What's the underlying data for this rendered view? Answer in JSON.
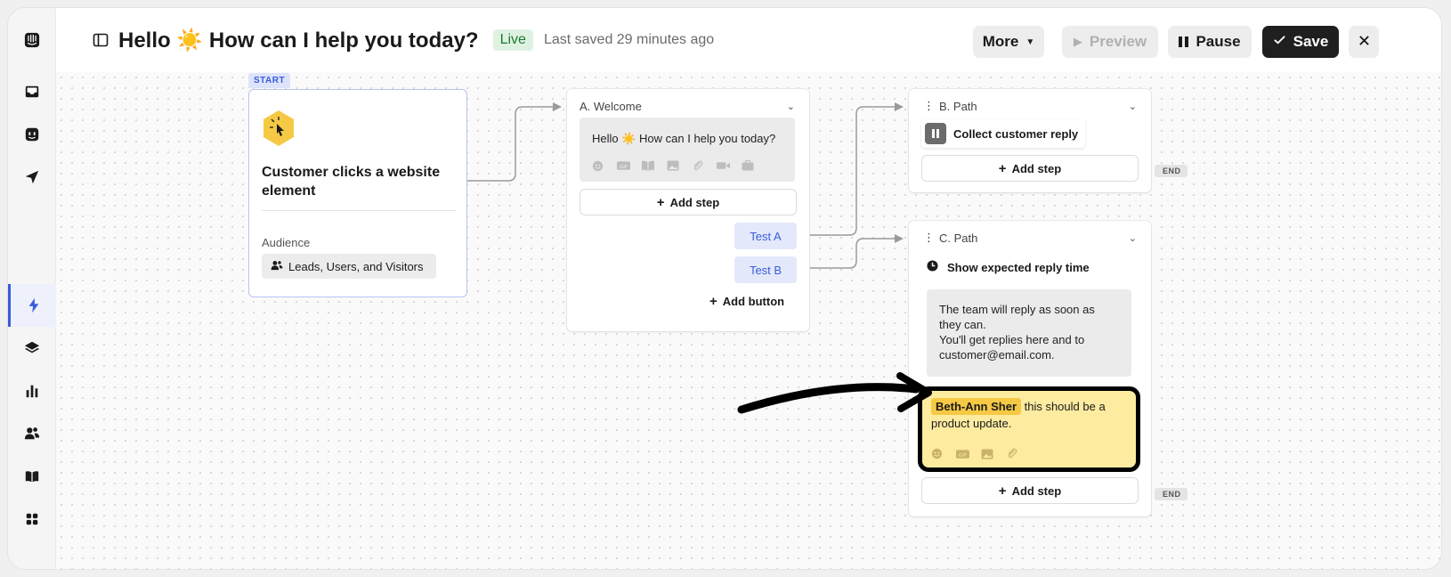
{
  "header": {
    "title": "Hello ☀️ How can I help you today?",
    "status": "Live",
    "last_saved": "Last saved 29 minutes ago",
    "more_label": "More",
    "preview_label": "Preview",
    "pause_label": "Pause",
    "save_label": "Save"
  },
  "start": {
    "badge": "START",
    "trigger": "Customer clicks a website element",
    "audience_label": "Audience",
    "audience_value": "Leads, Users, and Visitors"
  },
  "welcome": {
    "title": "A. Welcome",
    "message": "Hello ☀️ How can I help you today?",
    "add_step": "Add step",
    "buttons": [
      "Test A",
      "Test B"
    ],
    "add_button": "Add button"
  },
  "path_b": {
    "title": "B. Path",
    "step": "Collect customer reply",
    "add_step": "Add step",
    "end": "END"
  },
  "path_c": {
    "title": "C. Path",
    "step": "Show expected reply time",
    "reply_line1": "The team will reply as soon as they can.",
    "reply_line2": "You'll get replies here and to",
    "reply_email": "customer@email.com",
    "reply_period": ".",
    "note_mention": "Beth-Ann Sher",
    "note_text": " this should be a product update.",
    "add_step": "Add step",
    "end": "END"
  },
  "colors": {
    "accent": "#3b5bdb",
    "live_bg": "#dff2e1",
    "note_bg": "#fdeba0",
    "mention_bg": "#f6c945",
    "save_bg": "#1f1f1f"
  }
}
